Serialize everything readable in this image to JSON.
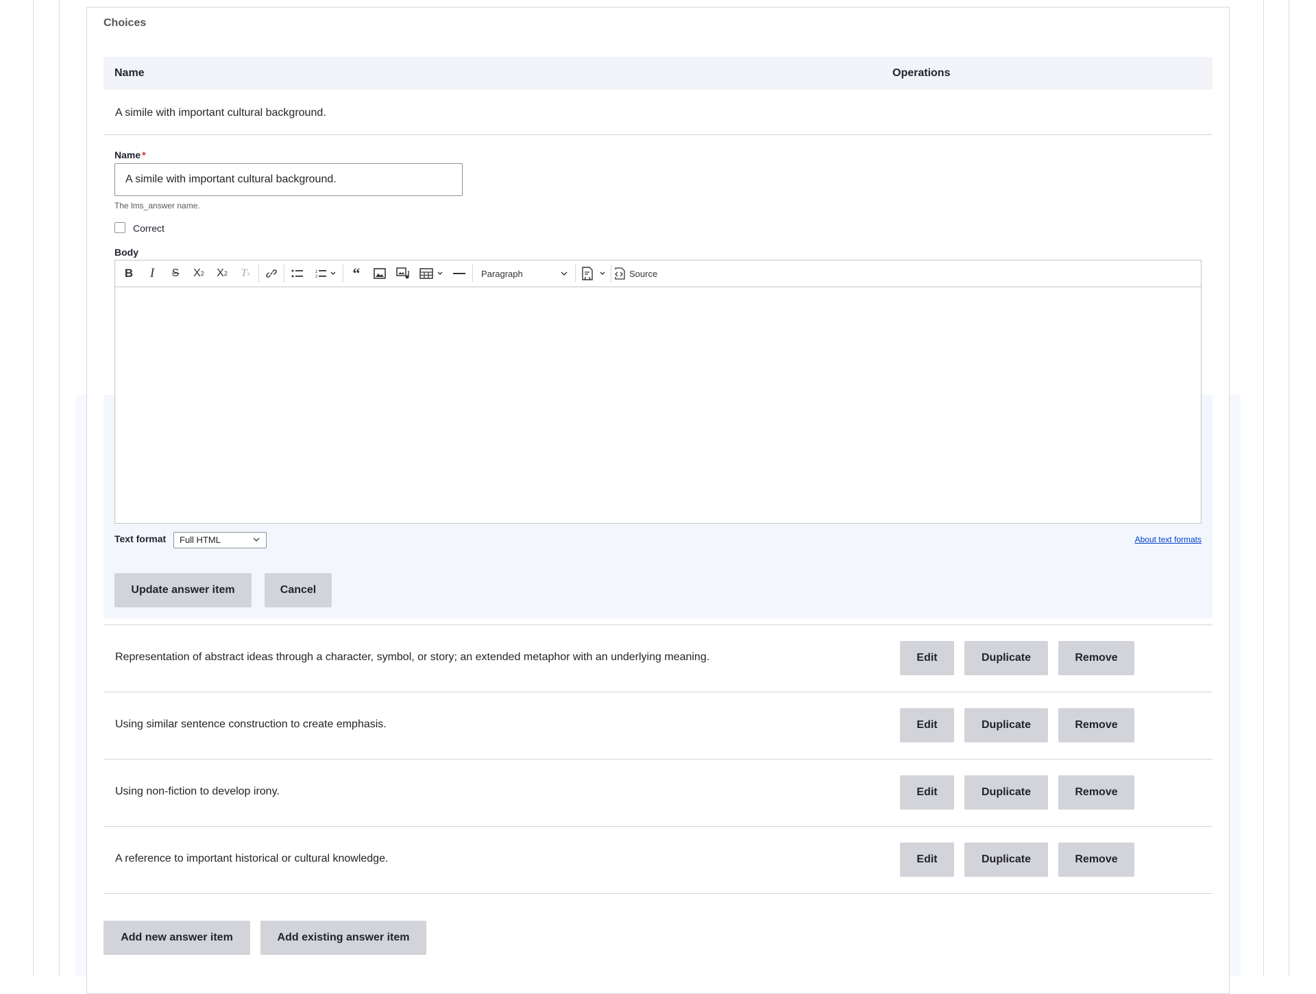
{
  "fieldset": {
    "legend": "Choices"
  },
  "table": {
    "headers": {
      "name": "Name",
      "operations": "Operations"
    },
    "editing_row_text": "A simile with important cultural background.",
    "rows": [
      {
        "text": "Representation of abstract ideas through a character, symbol, or story; an extended metaphor with an underlying meaning."
      },
      {
        "text": "Using similar sentence construction to create emphasis."
      },
      {
        "text": "Using non-fiction to develop irony."
      },
      {
        "text": "A reference to important historical or cultural knowledge."
      }
    ],
    "row_buttons": {
      "edit": "Edit",
      "duplicate": "Duplicate",
      "remove": "Remove"
    }
  },
  "edit_form": {
    "name_label": "Name",
    "required_mark": "*",
    "name_value": "A simile with important cultural background.",
    "name_description": "The lms_answer name.",
    "correct_label": "Correct",
    "correct_checked": false,
    "body_label": "Body",
    "toolbar": {
      "paragraph_label": "Paragraph",
      "source_label": "Source",
      "icons": [
        "bold-icon",
        "italic-icon",
        "strikethrough-icon",
        "superscript-icon",
        "subscript-icon",
        "remove-format-icon",
        "link-icon",
        "bulleted-list-icon",
        "numbered-list-icon",
        "blockquote-icon",
        "image-icon",
        "media-icon",
        "table-icon",
        "horizontal-line-icon",
        "code-block-icon",
        "source-icon"
      ]
    },
    "text_format_label": "Text format",
    "text_format_value": "Full HTML",
    "about_text_formats": "About text formats",
    "update_button": "Update answer item",
    "cancel_button": "Cancel"
  },
  "footer_buttons": {
    "add_new": "Add new answer item",
    "add_existing": "Add existing answer item"
  },
  "colors": {
    "button_bg": "#d3d4d9",
    "header_bg": "#f3f4f9",
    "link": "#003ecc",
    "required": "#dc2323"
  }
}
